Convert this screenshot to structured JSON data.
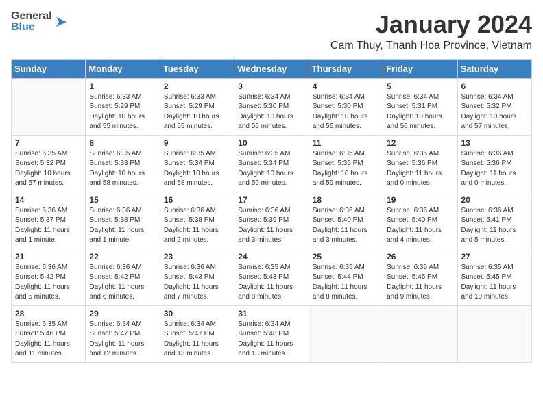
{
  "logo": {
    "line1": "General",
    "line2": "Blue"
  },
  "title": "January 2024",
  "subtitle": "Cam Thuy, Thanh Hoa Province, Vietnam",
  "weekdays": [
    "Sunday",
    "Monday",
    "Tuesday",
    "Wednesday",
    "Thursday",
    "Friday",
    "Saturday"
  ],
  "weeks": [
    [
      {
        "day": "",
        "info": ""
      },
      {
        "day": "1",
        "info": "Sunrise: 6:33 AM\nSunset: 5:29 PM\nDaylight: 10 hours\nand 55 minutes."
      },
      {
        "day": "2",
        "info": "Sunrise: 6:33 AM\nSunset: 5:29 PM\nDaylight: 10 hours\nand 55 minutes."
      },
      {
        "day": "3",
        "info": "Sunrise: 6:34 AM\nSunset: 5:30 PM\nDaylight: 10 hours\nand 56 minutes."
      },
      {
        "day": "4",
        "info": "Sunrise: 6:34 AM\nSunset: 5:30 PM\nDaylight: 10 hours\nand 56 minutes."
      },
      {
        "day": "5",
        "info": "Sunrise: 6:34 AM\nSunset: 5:31 PM\nDaylight: 10 hours\nand 56 minutes."
      },
      {
        "day": "6",
        "info": "Sunrise: 6:34 AM\nSunset: 5:32 PM\nDaylight: 10 hours\nand 57 minutes."
      }
    ],
    [
      {
        "day": "7",
        "info": "Sunrise: 6:35 AM\nSunset: 5:32 PM\nDaylight: 10 hours\nand 57 minutes."
      },
      {
        "day": "8",
        "info": "Sunrise: 6:35 AM\nSunset: 5:33 PM\nDaylight: 10 hours\nand 58 minutes."
      },
      {
        "day": "9",
        "info": "Sunrise: 6:35 AM\nSunset: 5:34 PM\nDaylight: 10 hours\nand 58 minutes."
      },
      {
        "day": "10",
        "info": "Sunrise: 6:35 AM\nSunset: 5:34 PM\nDaylight: 10 hours\nand 59 minutes."
      },
      {
        "day": "11",
        "info": "Sunrise: 6:35 AM\nSunset: 5:35 PM\nDaylight: 10 hours\nand 59 minutes."
      },
      {
        "day": "12",
        "info": "Sunrise: 6:35 AM\nSunset: 5:36 PM\nDaylight: 11 hours\nand 0 minutes."
      },
      {
        "day": "13",
        "info": "Sunrise: 6:36 AM\nSunset: 5:36 PM\nDaylight: 11 hours\nand 0 minutes."
      }
    ],
    [
      {
        "day": "14",
        "info": "Sunrise: 6:36 AM\nSunset: 5:37 PM\nDaylight: 11 hours\nand 1 minute."
      },
      {
        "day": "15",
        "info": "Sunrise: 6:36 AM\nSunset: 5:38 PM\nDaylight: 11 hours\nand 1 minute."
      },
      {
        "day": "16",
        "info": "Sunrise: 6:36 AM\nSunset: 5:38 PM\nDaylight: 11 hours\nand 2 minutes."
      },
      {
        "day": "17",
        "info": "Sunrise: 6:36 AM\nSunset: 5:39 PM\nDaylight: 11 hours\nand 3 minutes."
      },
      {
        "day": "18",
        "info": "Sunrise: 6:36 AM\nSunset: 5:40 PM\nDaylight: 11 hours\nand 3 minutes."
      },
      {
        "day": "19",
        "info": "Sunrise: 6:36 AM\nSunset: 5:40 PM\nDaylight: 11 hours\nand 4 minutes."
      },
      {
        "day": "20",
        "info": "Sunrise: 6:36 AM\nSunset: 5:41 PM\nDaylight: 11 hours\nand 5 minutes."
      }
    ],
    [
      {
        "day": "21",
        "info": "Sunrise: 6:36 AM\nSunset: 5:42 PM\nDaylight: 11 hours\nand 5 minutes."
      },
      {
        "day": "22",
        "info": "Sunrise: 6:36 AM\nSunset: 5:42 PM\nDaylight: 11 hours\nand 6 minutes."
      },
      {
        "day": "23",
        "info": "Sunrise: 6:36 AM\nSunset: 5:43 PM\nDaylight: 11 hours\nand 7 minutes."
      },
      {
        "day": "24",
        "info": "Sunrise: 6:35 AM\nSunset: 5:43 PM\nDaylight: 11 hours\nand 8 minutes."
      },
      {
        "day": "25",
        "info": "Sunrise: 6:35 AM\nSunset: 5:44 PM\nDaylight: 11 hours\nand 8 minutes."
      },
      {
        "day": "26",
        "info": "Sunrise: 6:35 AM\nSunset: 5:45 PM\nDaylight: 11 hours\nand 9 minutes."
      },
      {
        "day": "27",
        "info": "Sunrise: 6:35 AM\nSunset: 5:45 PM\nDaylight: 11 hours\nand 10 minutes."
      }
    ],
    [
      {
        "day": "28",
        "info": "Sunrise: 6:35 AM\nSunset: 5:46 PM\nDaylight: 11 hours\nand 11 minutes."
      },
      {
        "day": "29",
        "info": "Sunrise: 6:34 AM\nSunset: 5:47 PM\nDaylight: 11 hours\nand 12 minutes."
      },
      {
        "day": "30",
        "info": "Sunrise: 6:34 AM\nSunset: 5:47 PM\nDaylight: 11 hours\nand 13 minutes."
      },
      {
        "day": "31",
        "info": "Sunrise: 6:34 AM\nSunset: 5:48 PM\nDaylight: 11 hours\nand 13 minutes."
      },
      {
        "day": "",
        "info": ""
      },
      {
        "day": "",
        "info": ""
      },
      {
        "day": "",
        "info": ""
      }
    ]
  ]
}
